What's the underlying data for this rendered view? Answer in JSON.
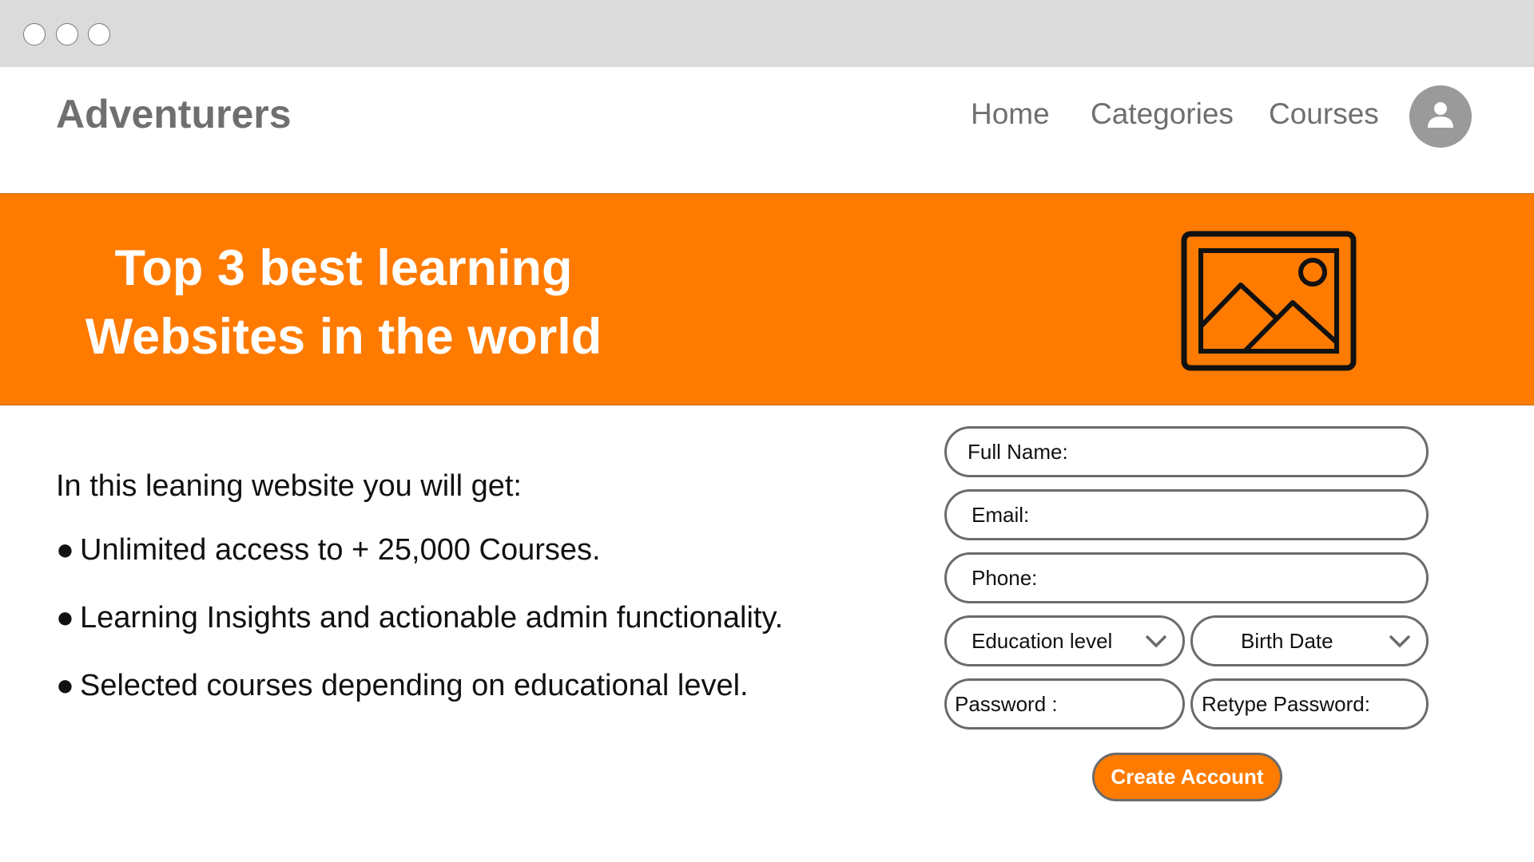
{
  "window": {
    "controls": [
      "window-dot",
      "window-dot",
      "window-dot"
    ]
  },
  "navbar": {
    "brand": "Adventurers",
    "links": [
      "Home",
      "Categories",
      "Courses"
    ],
    "avatar_icon": "user-icon"
  },
  "hero": {
    "title_line1": "Top 3 best learning",
    "title_line2": "Websites in the world",
    "image_icon": "image-placeholder-icon",
    "background_color": "#ff7b00"
  },
  "features": {
    "intro": "In this leaning website you will get:",
    "items": [
      "Unlimited access to + 25,000 Courses.",
      "Learning Insights and actionable admin functionality.",
      "Selected courses depending on educational level."
    ]
  },
  "form": {
    "full_name": "Full Name:",
    "email": "Email:",
    "phone": "Phone:",
    "education_level": "Education level",
    "birth_date": "Birth Date",
    "password": "Password :",
    "retype_password": "Retype Password:",
    "submit": "Create Account"
  }
}
